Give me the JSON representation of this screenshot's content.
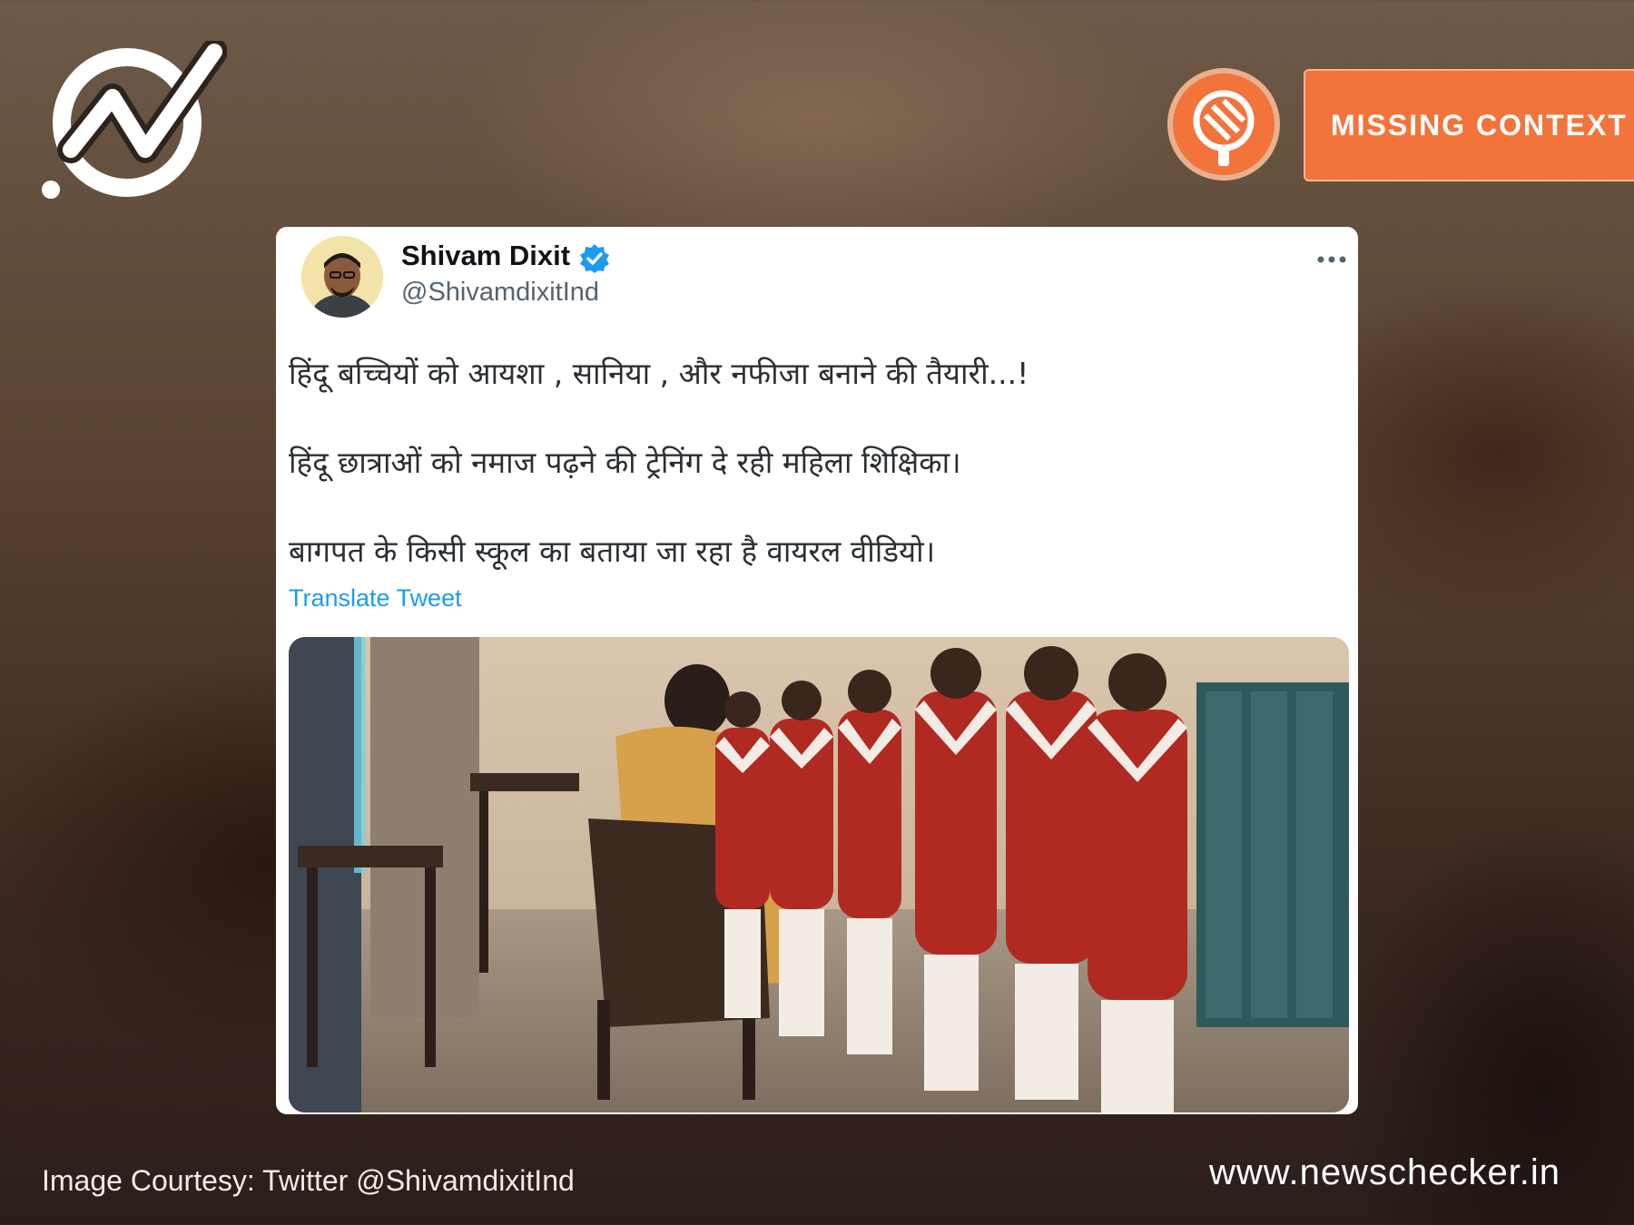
{
  "brand": {
    "logo_icon": "newschecker-check-logo",
    "seal_icon": "magnifier-seal-icon",
    "verdict_label": "MISSING CONTEXT",
    "accent_color": "#f2743b"
  },
  "tweet": {
    "author_name": "Shivam Dixit",
    "author_handle": "@ShivamdixitInd",
    "verified_icon": "verified-badge-icon",
    "more_icon": "more-options-icon",
    "lines": [
      "हिंदू बच्चियों को आयशा , सानिया , और नफीजा बनाने की तैयारी...!",
      "हिंदू छात्राओं को नमाज पढ़ने की ट्रेनिंग दे रही महिला शिक्षिका।",
      "बागपत के किसी स्कूल का बताया जा रहा है वायरल वीडियो।"
    ],
    "translate_label": "Translate Tweet",
    "media_description_icon": "classroom-video-thumbnail"
  },
  "footer": {
    "credit": "Image Courtesy: Twitter @ShivamdixitInd",
    "site": "www.newschecker.in"
  }
}
